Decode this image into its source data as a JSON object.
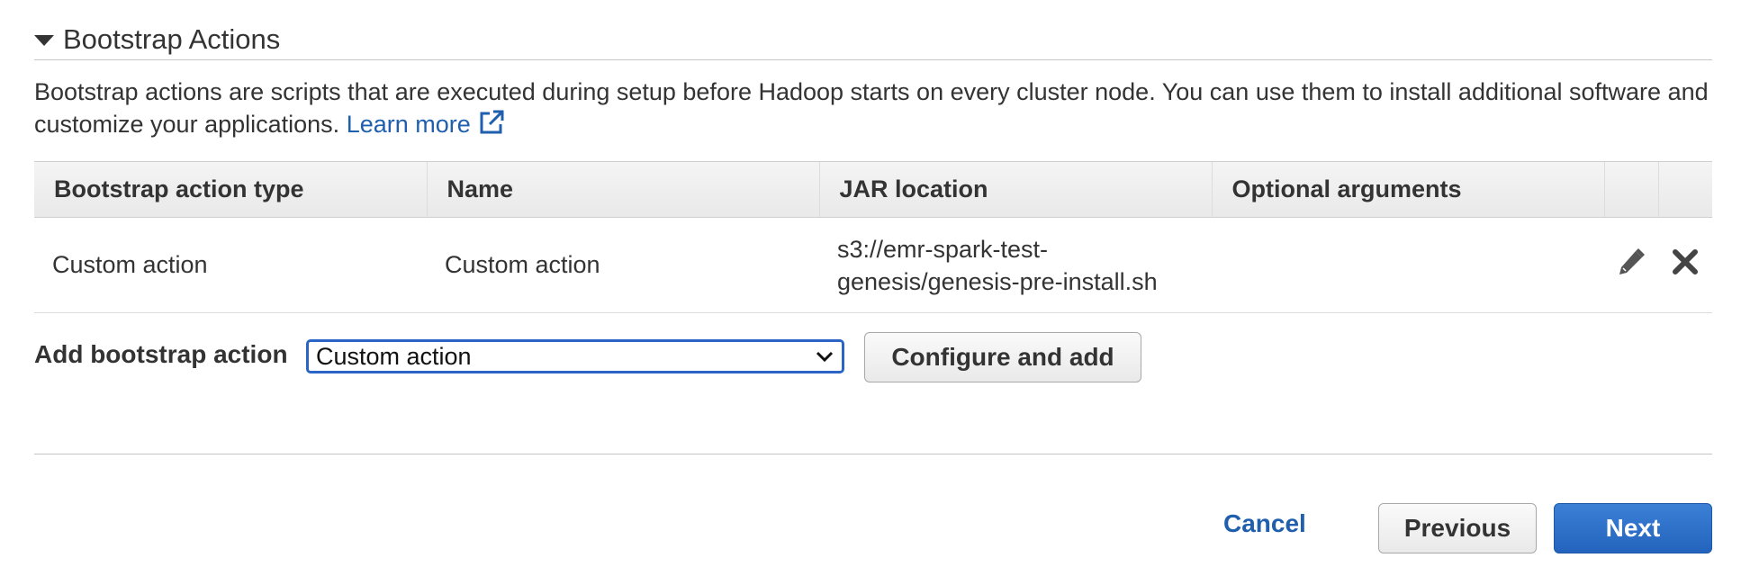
{
  "section": {
    "title": "Bootstrap Actions"
  },
  "description": {
    "text": "Bootstrap actions are scripts that are executed during setup before Hadoop starts on every cluster node. You can use them to install additional software and customize your applications.",
    "learn_more": "Learn more"
  },
  "table": {
    "headers": [
      "Bootstrap action type",
      "Name",
      "JAR location",
      "Optional arguments"
    ],
    "rows": [
      {
        "type": "Custom action",
        "name": "Custom action",
        "jar_location": "s3://emr-spark-test-genesis/genesis-pre-install.sh",
        "optional_arguments": "",
        "edit_icon": "pencil-icon",
        "delete_icon": "close-x-icon"
      }
    ]
  },
  "add_bootstrap": {
    "label": "Add bootstrap action",
    "selected": "Custom action",
    "configure_button": "Configure and add"
  },
  "footer": {
    "cancel": "Cancel",
    "previous": "Previous",
    "next": "Next"
  },
  "colors": {
    "link": "#1f5fae",
    "primary_button": "#2a6dc9",
    "select_focus": "#2a64c5",
    "text": "#333333"
  }
}
